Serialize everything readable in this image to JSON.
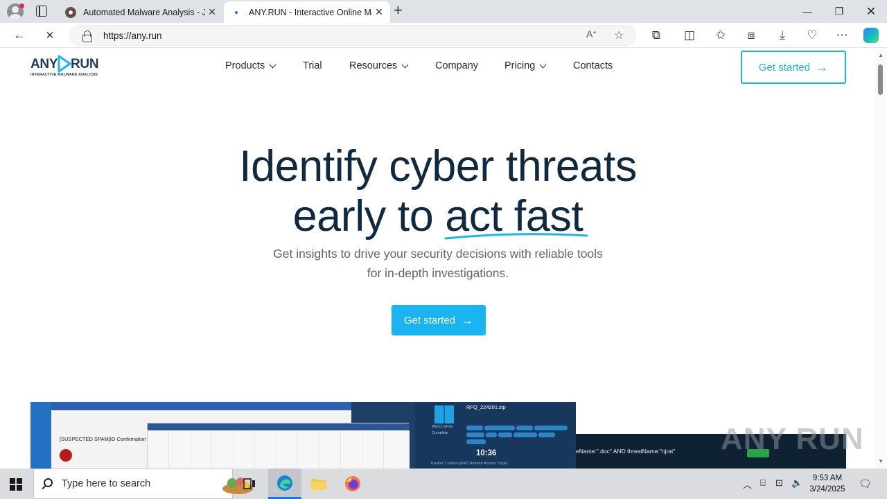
{
  "browser": {
    "tabs": [
      {
        "title": "Automated Malware Analysis - Jo",
        "active": false
      },
      {
        "title": "ANY.RUN - Interactive Online Ma",
        "active": true
      }
    ],
    "url": "https://any.run"
  },
  "site": {
    "logo": {
      "left": "ANY",
      "right": "RUN",
      "subtitle": "INTERACTIVE MALWARE ANALYSIS"
    },
    "nav": [
      {
        "label": "Products",
        "dropdown": true
      },
      {
        "label": "Trial",
        "dropdown": false
      },
      {
        "label": "Resources",
        "dropdown": true
      },
      {
        "label": "Company",
        "dropdown": false
      },
      {
        "label": "Pricing",
        "dropdown": true
      },
      {
        "label": "Contacts",
        "dropdown": false
      }
    ],
    "header_cta": "Get started",
    "hero": {
      "line1": "Identify cyber threats",
      "line2_a": "early to ",
      "line2_b": "act fast",
      "subtitle_1": "Get insights to drive your security decisions with reliable tools",
      "subtitle_2": "for in-depth investigations.",
      "cta": "Get started"
    },
    "preview": {
      "email_subject": "[SUSPECTED SPAM]ID Confirmation f",
      "file_name": "RFQ_224201.zip",
      "os": "Win11 64 bit",
      "status": "Complete",
      "timer": "10:36",
      "query": "eName:\".doc\" AND threatName:\"njrat\"",
      "search_label": "Search",
      "tracker": "Tracker:  Loader  njRAT  Remote Access Trojan"
    },
    "watermark": "ANY RUN"
  },
  "taskbar": {
    "search_placeholder": "Type here to search",
    "time": "9:53 AM",
    "date": "3/24/2025"
  },
  "colors": {
    "brand_cyan": "#1ab5f0",
    "brand_navy": "#0f2a40"
  }
}
